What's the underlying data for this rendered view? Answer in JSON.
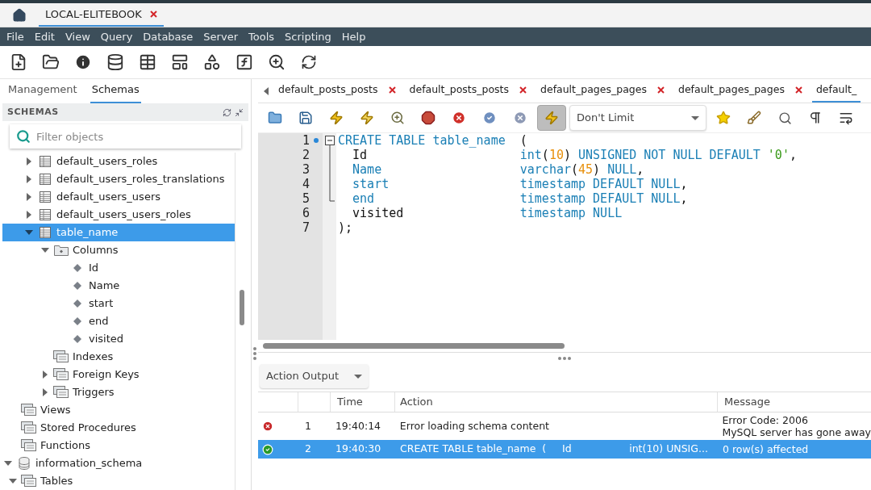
{
  "connection_tabs": [
    {
      "label": "LOCAL-ELITEBOOK",
      "selected": true
    }
  ],
  "menu": [
    "File",
    "Edit",
    "View",
    "Query",
    "Database",
    "Server",
    "Tools",
    "Scripting",
    "Help"
  ],
  "sidebar": {
    "tabs": [
      {
        "label": "Management",
        "selected": false
      },
      {
        "label": "Schemas",
        "selected": true
      }
    ],
    "header": "SCHEMAS",
    "filter": {
      "placeholder": "Filter objects"
    },
    "tree": [
      {
        "children": [
          {
            "children": [
              {
                "label": "default_users_roles",
                "kind": "table",
                "expanded": false,
                "selected": false
              },
              {
                "label": "default_users_roles_translations",
                "kind": "table",
                "expanded": false,
                "selected": false
              },
              {
                "label": "default_users_users",
                "kind": "table",
                "expanded": false,
                "selected": false
              },
              {
                "label": "default_users_users_roles",
                "kind": "table",
                "expanded": false,
                "selected": false
              },
              {
                "label": "table_name",
                "kind": "table",
                "expanded": true,
                "selected": true,
                "children": [
                  {
                    "label": "Columns",
                    "kind": "columns",
                    "expanded": true,
                    "selected": false,
                    "children": [
                      {
                        "label": "Id",
                        "kind": "column",
                        "selected": false
                      },
                      {
                        "label": "Name",
                        "kind": "column",
                        "selected": false
                      },
                      {
                        "label": "start",
                        "kind": "column",
                        "selected": false
                      },
                      {
                        "label": "end",
                        "kind": "column",
                        "selected": false
                      },
                      {
                        "label": "visited",
                        "kind": "column",
                        "selected": false
                      }
                    ]
                  },
                  {
                    "label": "Indexes",
                    "kind": "group",
                    "selected": false
                  },
                  {
                    "label": "Foreign Keys",
                    "kind": "group",
                    "expanded": false,
                    "selected": false
                  },
                  {
                    "label": "Triggers",
                    "kind": "group",
                    "expanded": false,
                    "selected": false
                  }
                ]
              }
            ]
          },
          {
            "label": "Views",
            "kind": "group",
            "selected": false
          },
          {
            "label": "Stored Procedures",
            "kind": "group",
            "selected": false
          },
          {
            "label": "Functions",
            "kind": "group",
            "selected": false
          }
        ]
      },
      {
        "label": "information_schema",
        "kind": "schema",
        "expanded": true,
        "selected": false,
        "children": [
          {
            "label": "Tables",
            "kind": "group",
            "expanded": true,
            "selected": false
          }
        ]
      }
    ]
  },
  "editor_tabs": [
    {
      "label": "default_posts_posts",
      "selected": false,
      "closable": true
    },
    {
      "label": "default_posts_posts",
      "selected": false,
      "closable": true
    },
    {
      "label": "default_pages_pages",
      "selected": false,
      "closable": true
    },
    {
      "label": "default_pages_pages",
      "selected": false,
      "closable": true
    },
    {
      "label": "default_",
      "selected": true,
      "closable": false
    }
  ],
  "editor_toolbar": {
    "autocommit_on": true,
    "limit": "Don't Limit"
  },
  "code_lines": [
    {
      "number": "1",
      "active_statement": true,
      "indent": false,
      "name": [
        {
          "kind": "keyword",
          "text": "CREATE TABLE table_name"
        }
      ],
      "rest": [
        {
          "kind": "plain",
          "text": "("
        }
      ]
    },
    {
      "number": "2",
      "indent": true,
      "name": [
        {
          "kind": "plain",
          "text": "Id"
        }
      ],
      "rest": [
        {
          "kind": "keyword",
          "text": "int"
        },
        {
          "kind": "plain",
          "text": "("
        },
        {
          "kind": "number",
          "text": "10"
        },
        {
          "kind": "plain",
          "text": ")"
        },
        {
          "kind": "keyword",
          "text": " UNSIGNED NOT NULL DEFAULT "
        },
        {
          "kind": "string",
          "text": "'0'"
        },
        {
          "kind": "plain",
          "text": ","
        }
      ]
    },
    {
      "number": "3",
      "indent": true,
      "name": [
        {
          "kind": "keyword",
          "text": "Name"
        }
      ],
      "rest": [
        {
          "kind": "keyword",
          "text": "varchar"
        },
        {
          "kind": "plain",
          "text": "("
        },
        {
          "kind": "number",
          "text": "45"
        },
        {
          "kind": "plain",
          "text": ")"
        },
        {
          "kind": "keyword",
          "text": " NULL"
        },
        {
          "kind": "plain",
          "text": ","
        }
      ]
    },
    {
      "number": "4",
      "indent": true,
      "name": [
        {
          "kind": "keyword",
          "text": "start"
        }
      ],
      "rest": [
        {
          "kind": "keyword",
          "text": "timestamp DEFAULT NULL"
        },
        {
          "kind": "plain",
          "text": ","
        }
      ]
    },
    {
      "number": "5",
      "indent": true,
      "name": [
        {
          "kind": "keyword",
          "text": "end"
        }
      ],
      "rest": [
        {
          "kind": "keyword",
          "text": "timestamp DEFAULT NULL"
        },
        {
          "kind": "plain",
          "text": ","
        }
      ]
    },
    {
      "number": "6",
      "indent": true,
      "name": [
        {
          "kind": "plain",
          "text": "visited"
        }
      ],
      "rest": [
        {
          "kind": "keyword",
          "text": "timestamp NULL"
        }
      ]
    },
    {
      "number": "7",
      "indent": false,
      "name": [
        {
          "kind": "plain",
          "text": ");"
        }
      ]
    }
  ],
  "output": {
    "selector": "Action Output",
    "columns": [
      "Time",
      "Action",
      "Message"
    ],
    "rows": [
      {
        "kind": "error",
        "number": "1",
        "time": "19:40:14",
        "action": "Error loading schema content",
        "message": "Error Code: 2006\nMySQL server has gone away",
        "selected": false
      },
      {
        "kind": "ok",
        "number": "2",
        "time": "19:40:30",
        "action": "CREATE TABLE table_name  (     Id                  int(10) UNSIG...",
        "message": "0 row(s) affected",
        "selected": true
      }
    ]
  }
}
